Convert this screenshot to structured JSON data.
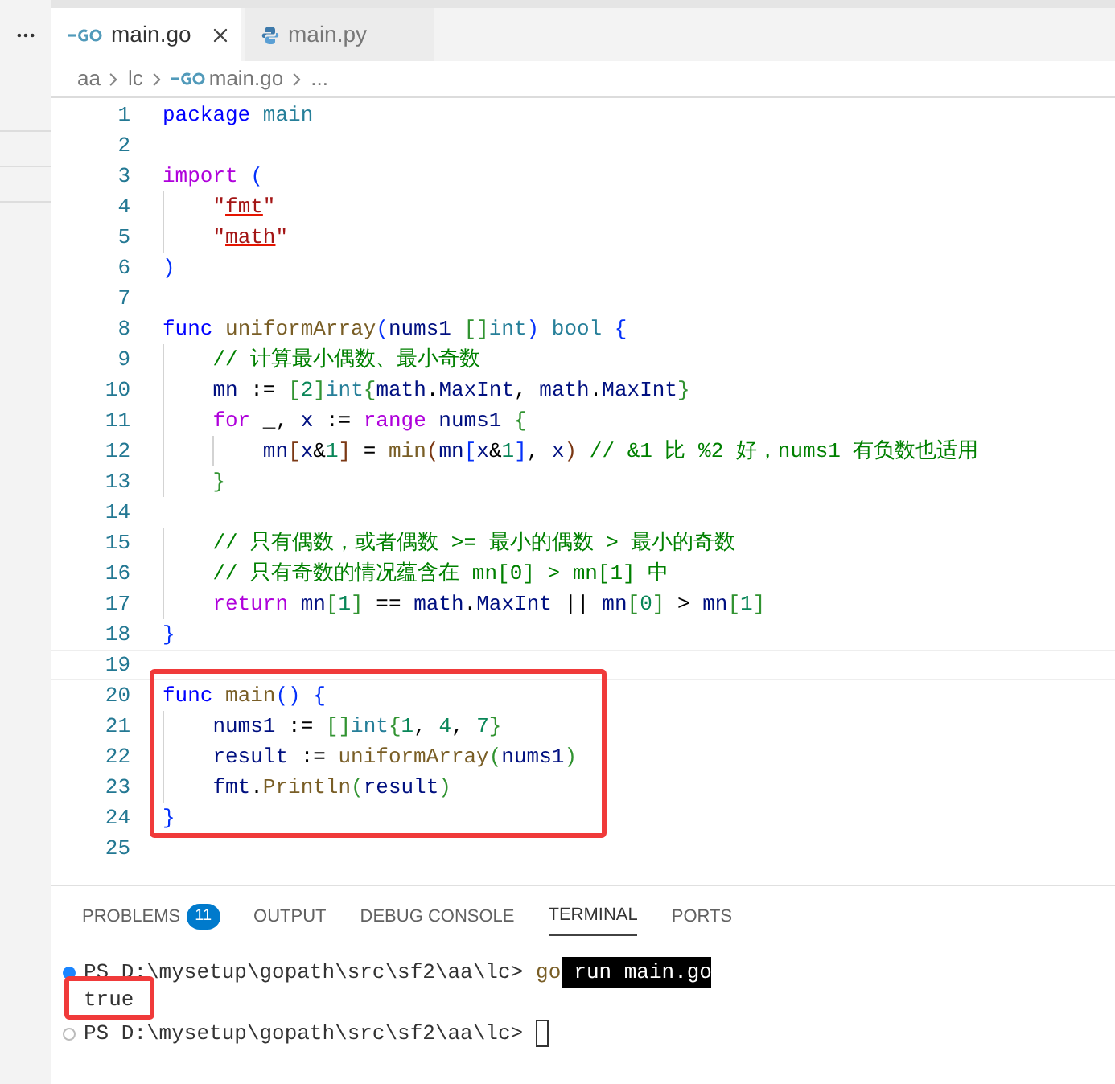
{
  "tabs": [
    {
      "label": "main.go",
      "kind": "go",
      "selected": true
    },
    {
      "label": "main.py",
      "kind": "python",
      "selected": false
    }
  ],
  "breadcrumb": [
    {
      "label": "aa",
      "kind": "folder"
    },
    {
      "label": "lc",
      "kind": "folder"
    },
    {
      "label": "main.go",
      "kind": "go"
    },
    {
      "label": "...",
      "kind": "symbol"
    }
  ],
  "editor": {
    "lines": [
      {
        "number": "1",
        "current": false,
        "tokens": [
          {
            "kind": "kw",
            "text": "package"
          },
          {
            "kind": "type",
            "text": " main"
          }
        ]
      },
      {
        "number": "2",
        "current": false
      },
      {
        "number": "3",
        "current": false,
        "tokens": [
          {
            "kind": "ctrl",
            "text": "import"
          },
          {
            "kind": "br1",
            "text": " ("
          }
        ]
      },
      {
        "number": "4",
        "current": false,
        "tokens": [
          {
            "kind": "str",
            "text": "    \""
          },
          {
            "kind": "strerr",
            "text": "fmt"
          },
          {
            "kind": "str",
            "text": "\""
          }
        ]
      },
      {
        "number": "5",
        "current": false,
        "tokens": [
          {
            "kind": "str",
            "text": "    \""
          },
          {
            "kind": "strerr",
            "text": "math"
          },
          {
            "kind": "str",
            "text": "\""
          }
        ]
      },
      {
        "number": "6",
        "current": false,
        "tokens": [
          {
            "kind": "br1",
            "text": ")"
          }
        ]
      },
      {
        "number": "7",
        "current": false
      },
      {
        "number": "8",
        "current": false,
        "tokens": [
          {
            "kind": "kw",
            "text": "func"
          },
          {
            "kind": "fn",
            "text": " uniformArray"
          },
          {
            "kind": "br1",
            "text": "("
          },
          {
            "kind": "var",
            "text": "nums1"
          },
          {
            "kind": "br2",
            "text": " []"
          },
          {
            "kind": "type",
            "text": "int"
          },
          {
            "kind": "br1",
            "text": ")"
          },
          {
            "kind": "type",
            "text": " bool"
          },
          {
            "kind": "br1",
            "text": " {"
          }
        ]
      },
      {
        "number": "9",
        "current": false,
        "tokens": [
          {
            "kind": "cmt",
            "text": "    // 计算最小偶数、最小奇数"
          }
        ]
      },
      {
        "number": "10",
        "current": false,
        "tokens": [
          {
            "kind": "var",
            "text": "    mn"
          },
          {
            "kind": "plain",
            "text": " := "
          },
          {
            "kind": "br2",
            "text": "["
          },
          {
            "kind": "num",
            "text": "2"
          },
          {
            "kind": "br2",
            "text": "]"
          },
          {
            "kind": "type",
            "text": "int"
          },
          {
            "kind": "br2",
            "text": "{"
          },
          {
            "kind": "var",
            "text": "math"
          },
          {
            "kind": "plain",
            "text": "."
          },
          {
            "kind": "var",
            "text": "MaxInt"
          },
          {
            "kind": "plain",
            "text": ", "
          },
          {
            "kind": "var",
            "text": "math"
          },
          {
            "kind": "plain",
            "text": "."
          },
          {
            "kind": "var",
            "text": "MaxInt"
          },
          {
            "kind": "br2",
            "text": "}"
          }
        ]
      },
      {
        "number": "11",
        "current": false,
        "tokens": [
          {
            "kind": "ctrl",
            "text": "    for"
          },
          {
            "kind": "plain",
            "text": " _, "
          },
          {
            "kind": "var",
            "text": "x"
          },
          {
            "kind": "plain",
            "text": " := "
          },
          {
            "kind": "ctrl",
            "text": "range"
          },
          {
            "kind": "var",
            "text": " nums1"
          },
          {
            "kind": "br2",
            "text": " {"
          }
        ]
      },
      {
        "number": "12",
        "current": false,
        "tokens": [
          {
            "kind": "var",
            "text": "        mn"
          },
          {
            "kind": "br3",
            "text": "["
          },
          {
            "kind": "var",
            "text": "x"
          },
          {
            "kind": "plain",
            "text": "&"
          },
          {
            "kind": "num",
            "text": "1"
          },
          {
            "kind": "br3",
            "text": "]"
          },
          {
            "kind": "plain",
            "text": " = "
          },
          {
            "kind": "fn",
            "text": "min"
          },
          {
            "kind": "br3",
            "text": "("
          },
          {
            "kind": "var",
            "text": "mn"
          },
          {
            "kind": "br1",
            "text": "["
          },
          {
            "kind": "var",
            "text": "x"
          },
          {
            "kind": "plain",
            "text": "&"
          },
          {
            "kind": "num",
            "text": "1"
          },
          {
            "kind": "br1",
            "text": "]"
          },
          {
            "kind": "plain",
            "text": ", "
          },
          {
            "kind": "var",
            "text": "x"
          },
          {
            "kind": "br3",
            "text": ")"
          },
          {
            "kind": "cmt",
            "text": " // &1 比 %2 好，nums1 有负数也适用"
          }
        ]
      },
      {
        "number": "13",
        "current": false,
        "tokens": [
          {
            "kind": "br2",
            "text": "    }"
          }
        ]
      },
      {
        "number": "14",
        "current": false
      },
      {
        "number": "15",
        "current": false,
        "tokens": [
          {
            "kind": "cmt",
            "text": "    // 只有偶数，或者偶数 >= 最小的偶数 > 最小的奇数"
          }
        ]
      },
      {
        "number": "16",
        "current": false,
        "tokens": [
          {
            "kind": "cmt",
            "text": "    // 只有奇数的情况蕴含在 mn[0] > mn[1] 中"
          }
        ]
      },
      {
        "number": "17",
        "current": false,
        "tokens": [
          {
            "kind": "ctrl",
            "text": "    return"
          },
          {
            "kind": "var",
            "text": " mn"
          },
          {
            "kind": "br2",
            "text": "["
          },
          {
            "kind": "num",
            "text": "1"
          },
          {
            "kind": "br2",
            "text": "]"
          },
          {
            "kind": "plain",
            "text": " == "
          },
          {
            "kind": "var",
            "text": "math"
          },
          {
            "kind": "plain",
            "text": "."
          },
          {
            "kind": "var",
            "text": "MaxInt"
          },
          {
            "kind": "plain",
            "text": " || "
          },
          {
            "kind": "var",
            "text": "mn"
          },
          {
            "kind": "br2",
            "text": "["
          },
          {
            "kind": "num",
            "text": "0"
          },
          {
            "kind": "br2",
            "text": "]"
          },
          {
            "kind": "plain",
            "text": " > "
          },
          {
            "kind": "var",
            "text": "mn"
          },
          {
            "kind": "br2",
            "text": "["
          },
          {
            "kind": "num",
            "text": "1"
          },
          {
            "kind": "br2",
            "text": "]"
          }
        ]
      },
      {
        "number": "18",
        "current": false,
        "tokens": [
          {
            "kind": "br1",
            "text": "}"
          }
        ]
      },
      {
        "number": "19",
        "current": true
      },
      {
        "number": "20",
        "current": false,
        "tokens": [
          {
            "kind": "kw",
            "text": "func"
          },
          {
            "kind": "fn",
            "text": " main"
          },
          {
            "kind": "br1",
            "text": "()"
          },
          {
            "kind": "br1",
            "text": " {"
          }
        ]
      },
      {
        "number": "21",
        "current": false,
        "tokens": [
          {
            "kind": "var",
            "text": "    nums1"
          },
          {
            "kind": "plain",
            "text": " := "
          },
          {
            "kind": "br2",
            "text": "[]"
          },
          {
            "kind": "type",
            "text": "int"
          },
          {
            "kind": "br2",
            "text": "{"
          },
          {
            "kind": "num",
            "text": "1"
          },
          {
            "kind": "plain",
            "text": ", "
          },
          {
            "kind": "num",
            "text": "4"
          },
          {
            "kind": "plain",
            "text": ", "
          },
          {
            "kind": "num",
            "text": "7"
          },
          {
            "kind": "br2",
            "text": "}"
          }
        ]
      },
      {
        "number": "22",
        "current": false,
        "tokens": [
          {
            "kind": "var",
            "text": "    result"
          },
          {
            "kind": "plain",
            "text": " := "
          },
          {
            "kind": "fn",
            "text": "uniformArray"
          },
          {
            "kind": "br2",
            "text": "("
          },
          {
            "kind": "var",
            "text": "nums1"
          },
          {
            "kind": "br2",
            "text": ")"
          }
        ]
      },
      {
        "number": "23",
        "current": false,
        "tokens": [
          {
            "kind": "var",
            "text": "    fmt"
          },
          {
            "kind": "plain",
            "text": "."
          },
          {
            "kind": "fn",
            "text": "Println"
          },
          {
            "kind": "br2",
            "text": "("
          },
          {
            "kind": "var",
            "text": "result"
          },
          {
            "kind": "br2",
            "text": ")"
          }
        ]
      },
      {
        "number": "24",
        "current": false,
        "tokens": [
          {
            "kind": "br1",
            "text": "}"
          }
        ]
      },
      {
        "number": "25",
        "current": false
      }
    ]
  },
  "panel": {
    "tabs": [
      {
        "label": "PROBLEMS",
        "badge": "11",
        "selected": false
      },
      {
        "label": "OUTPUT",
        "selected": false
      },
      {
        "label": "DEBUG CONSOLE",
        "selected": false
      },
      {
        "label": "TERMINAL",
        "selected": true
      },
      {
        "label": "PORTS",
        "selected": false
      }
    ],
    "terminal": [
      {
        "kind": "command",
        "succeeded": true,
        "prompt": "PS D:\\mysetup\\gopath\\src\\sf2\\aa\\lc>",
        "command": "go",
        "args": "run main.go",
        "args_selected": true
      },
      {
        "kind": "output",
        "text": "true"
      },
      {
        "kind": "input",
        "succeeded": false,
        "prompt": "PS D:\\mysetup\\gopath\\src\\sf2\\aa\\lc>"
      }
    ]
  }
}
